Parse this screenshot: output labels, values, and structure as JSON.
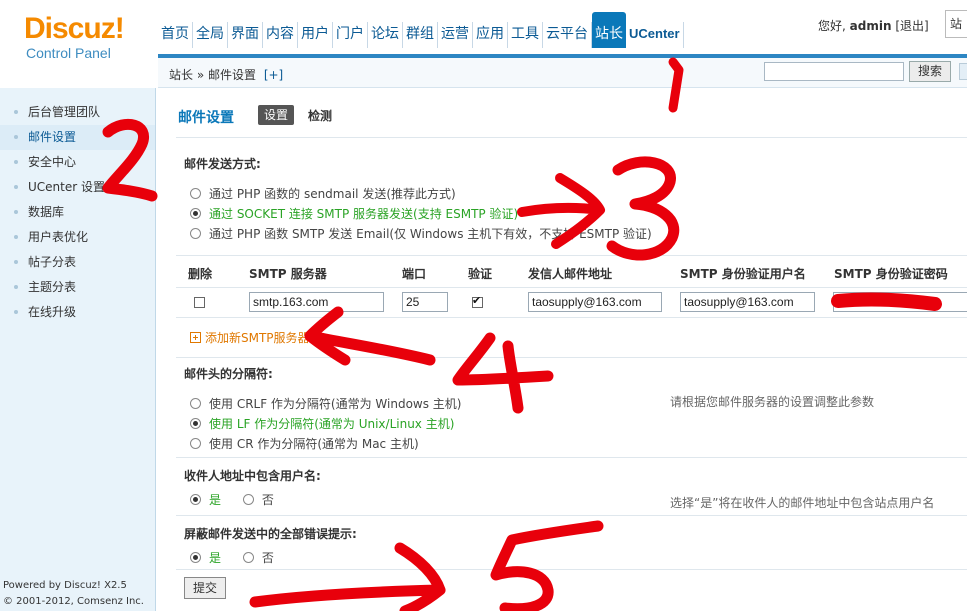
{
  "header": {
    "logo_brand": "Discuz!",
    "logo_sub": "Control Panel",
    "nav": [
      "首页",
      "全局",
      "界面",
      "内容",
      "用户",
      "门户",
      "论坛",
      "群组",
      "运营",
      "应用",
      "工具",
      "云平台",
      "站长",
      "UCenter"
    ],
    "active_nav": "站长",
    "greeting": "您好,",
    "username": "admin",
    "logout": "[退出]",
    "right_cut": "站"
  },
  "breadcrumb": {
    "path": "站长 » 邮件设置",
    "add": "[+]",
    "search_button": "搜索"
  },
  "sidebar": {
    "items": [
      "后台管理团队",
      "邮件设置",
      "安全中心",
      "UCenter 设置",
      "数据库",
      "用户表优化",
      "帖子分表",
      "主题分表",
      "在线升级"
    ],
    "active": "邮件设置",
    "footer_line1": "Powered by Discuz! X2.5",
    "footer_line2": "© 2001-2012, Comsenz Inc."
  },
  "main": {
    "title": "邮件设置",
    "tab_settings": "设置",
    "tab_test": "检测",
    "send_method_title": "邮件发送方式:",
    "send_methods": [
      "通过 PHP 函数的 sendmail 发送(推荐此方式)",
      "通过 SOCKET 连接 SMTP 服务器发送(支持 ESMTP 验证)",
      "通过 PHP 函数 SMTP 发送 Email(仅 Windows 主机下有效，不支持 ESMTP 验证)"
    ],
    "send_method_selected": 1,
    "table_headers": [
      "删除",
      "SMTP 服务器",
      "端口",
      "验证",
      "发信人邮件地址",
      "SMTP 身份验证用户名",
      "SMTP 身份验证密码"
    ],
    "row": {
      "server": "smtp.163.com",
      "port": "25",
      "auth": true,
      "from": "taosupply@163.com",
      "user": "taosupply@163.com"
    },
    "add_server": "添加新SMTP服务器",
    "separator_title": "邮件头的分隔符:",
    "separators": [
      "使用 CRLF 作为分隔符(通常为 Windows 主机)",
      "使用 LF 作为分隔符(通常为 Unix/Linux 主机)",
      "使用 CR 作为分隔符(通常为 Mac 主机)"
    ],
    "separator_selected": 1,
    "separator_hint": "请根据您邮件服务器的设置调整此参数",
    "include_user_title": "收件人地址中包含用户名:",
    "yes": "是",
    "no": "否",
    "include_user_hint": "选择“是”将在收件人的邮件地址中包含站点用户名",
    "silent_title": "屏蔽邮件发送中的全部错误提示:",
    "submit": "提交"
  },
  "annotations": [
    "1",
    "2",
    "3",
    "4",
    "5"
  ],
  "colors": {
    "accent": "#0a78b9",
    "selected_green": "#2aa325",
    "marker_red": "#e8000b",
    "logo_orange": "#f58a00"
  }
}
